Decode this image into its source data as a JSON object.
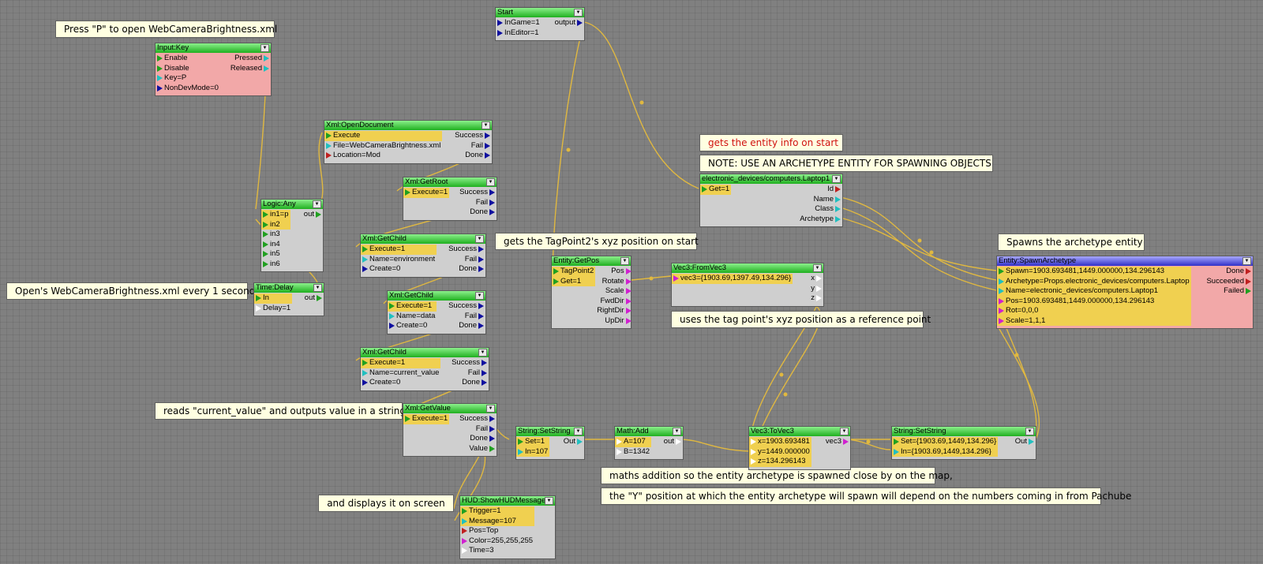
{
  "comments": {
    "press_p": "Press \"P\" to open WebCameraBrightness.xml",
    "opens_xml": "Open's WebCameraBrightness.xml every 1 second",
    "entity_info": "gets the entity info on start",
    "note_archetype": "NOTE: USE AN ARCHETYPE ENTITY FOR SPAWNING OBJECTS",
    "tagpoint": "gets the TagPoint2's xyz position on start",
    "spawns": "Spawns the archetype entity",
    "reference": "uses the tag point's xyz position as a reference point",
    "reads_value": "reads \"current_value\" and outputs value in a string",
    "displays": "and displays it on screen",
    "maths": "maths addition so the entity archetype is spawned close by on the map,",
    "y_position": "the \"Y\" position at which the entity archetype will spawn will depend on the numbers coming in from Pachube"
  },
  "nodes": {
    "start": {
      "title": "Start",
      "inputs": [
        {
          "label": "InGame=1",
          "color": "blue"
        },
        {
          "label": "InEditor=1",
          "color": "blue"
        }
      ],
      "outputs": [
        {
          "label": "output",
          "color": "blue"
        }
      ]
    },
    "input_key": {
      "title": "Input:Key",
      "inputs": [
        {
          "label": "Enable",
          "color": "green"
        },
        {
          "label": "Disable",
          "color": "green"
        },
        {
          "label": "Key=P",
          "color": "cyan"
        },
        {
          "label": "NonDevMode=0",
          "color": "blue"
        }
      ],
      "outputs": [
        {
          "label": "Pressed",
          "color": "cyan"
        },
        {
          "label": "Released",
          "color": "cyan"
        }
      ]
    },
    "xml_open": {
      "title": "Xml:OpenDocument",
      "inputs": [
        {
          "label": "Execute",
          "color": "green",
          "hl": true
        },
        {
          "label": "File=WebCameraBrightness.xml",
          "color": "cyan"
        },
        {
          "label": "Location=Mod",
          "color": "red"
        }
      ],
      "outputs": [
        {
          "label": "Success",
          "color": "blue"
        },
        {
          "label": "Fail",
          "color": "blue"
        },
        {
          "label": "Done",
          "color": "blue"
        }
      ]
    },
    "xml_getroot": {
      "title": "Xml:GetRoot",
      "inputs": [
        {
          "label": "Execute=1",
          "color": "green",
          "hl": true
        }
      ],
      "outputs": [
        {
          "label": "Success",
          "color": "blue"
        },
        {
          "label": "Fail",
          "color": "blue"
        },
        {
          "label": "Done",
          "color": "blue"
        }
      ]
    },
    "logic_any": {
      "title": "Logic:Any",
      "inputs": [
        {
          "label": "in1=p",
          "color": "green",
          "hl": true
        },
        {
          "label": "in2",
          "color": "green",
          "hl": true
        },
        {
          "label": "in3",
          "color": "green"
        },
        {
          "label": "in4",
          "color": "green"
        },
        {
          "label": "in5",
          "color": "green"
        },
        {
          "label": "in6",
          "color": "green"
        }
      ],
      "outputs": [
        {
          "label": "out",
          "color": "green"
        }
      ]
    },
    "xml_getchild1": {
      "title": "Xml:GetChild",
      "inputs": [
        {
          "label": "Execute=1",
          "color": "green",
          "hl": true
        },
        {
          "label": "Name=environment",
          "color": "cyan"
        },
        {
          "label": "Create=0",
          "color": "blue"
        }
      ],
      "outputs": [
        {
          "label": "Success",
          "color": "blue"
        },
        {
          "label": "Fail",
          "color": "blue"
        },
        {
          "label": "Done",
          "color": "blue"
        }
      ]
    },
    "time_delay": {
      "title": "Time:Delay",
      "inputs": [
        {
          "label": "In",
          "color": "green",
          "hl": true
        },
        {
          "label": "Delay=1",
          "color": "hollow"
        }
      ],
      "outputs": [
        {
          "label": "out",
          "color": "green"
        }
      ]
    },
    "xml_getchild2": {
      "title": "Xml:GetChild",
      "inputs": [
        {
          "label": "Execute=1",
          "color": "green",
          "hl": true
        },
        {
          "label": "Name=data",
          "color": "cyan"
        },
        {
          "label": "Create=0",
          "color": "blue"
        }
      ],
      "outputs": [
        {
          "label": "Success",
          "color": "blue"
        },
        {
          "label": "Fail",
          "color": "blue"
        },
        {
          "label": "Done",
          "color": "blue"
        }
      ]
    },
    "xml_getchild3": {
      "title": "Xml:GetChild",
      "inputs": [
        {
          "label": "Execute=1",
          "color": "green",
          "hl": true
        },
        {
          "label": "Name=current_value",
          "color": "cyan"
        },
        {
          "label": "Create=0",
          "color": "blue"
        }
      ],
      "outputs": [
        {
          "label": "Success",
          "color": "blue"
        },
        {
          "label": "Fail",
          "color": "blue"
        },
        {
          "label": "Done",
          "color": "blue"
        }
      ]
    },
    "xml_getvalue": {
      "title": "Xml:GetValue",
      "inputs": [
        {
          "label": "Execute=1",
          "color": "green",
          "hl": true
        }
      ],
      "outputs": [
        {
          "label": "Success",
          "color": "blue"
        },
        {
          "label": "Fail",
          "color": "blue"
        },
        {
          "label": "Done",
          "color": "blue"
        },
        {
          "label": "Value",
          "color": "green"
        }
      ]
    },
    "hud_message": {
      "title": "HUD:ShowHUDMessage",
      "inputs": [
        {
          "label": "Trigger=1",
          "color": "green",
          "hl": true
        },
        {
          "label": "Message=107",
          "color": "cyan",
          "hl": true
        },
        {
          "label": "Pos=Top",
          "color": "red"
        },
        {
          "label": "Color=255,255,255",
          "color": "magenta"
        },
        {
          "label": "Time=3",
          "color": "hollow"
        }
      ],
      "outputs": []
    },
    "string_set1": {
      "title": "String:SetString",
      "inputs": [
        {
          "label": "Set=1",
          "color": "green",
          "hl": true
        },
        {
          "label": "In=107",
          "color": "cyan",
          "hl": true
        }
      ],
      "outputs": [
        {
          "label": "Out",
          "color": "cyan"
        }
      ]
    },
    "math_add": {
      "title": "Math:Add",
      "inputs": [
        {
          "label": "A=107",
          "color": "hollow",
          "hl": true
        },
        {
          "label": "B=1342",
          "color": "hollow"
        }
      ],
      "outputs": [
        {
          "label": "out",
          "color": "hollow"
        }
      ]
    },
    "entity_getpos": {
      "title": "Entity:GetPos",
      "inputs": [
        {
          "label": "TagPoint2",
          "color": "green",
          "hl": true
        },
        {
          "label": "Get=1",
          "color": "green",
          "hl": true
        }
      ],
      "outputs": [
        {
          "label": "Pos",
          "color": "magenta"
        },
        {
          "label": "Rotate",
          "color": "magenta"
        },
        {
          "label": "Scale",
          "color": "magenta"
        },
        {
          "label": "FwdDir",
          "color": "magenta"
        },
        {
          "label": "RightDir",
          "color": "magenta"
        },
        {
          "label": "UpDir",
          "color": "magenta"
        }
      ]
    },
    "vec3_from": {
      "title": "Vec3:FromVec3",
      "inputs": [
        {
          "label": "vec3={1903.69,1397.49,134.296}",
          "color": "magenta",
          "hl": true
        }
      ],
      "outputs": [
        {
          "label": "x",
          "color": "hollow"
        },
        {
          "label": "y",
          "color": "hollow"
        },
        {
          "label": "z",
          "color": "hollow"
        }
      ]
    },
    "entity_laptop": {
      "title": "electronic_devices/computers.Laptop1",
      "inputs": [
        {
          "label": "Get=1",
          "color": "green",
          "hl": true
        }
      ],
      "outputs": [
        {
          "label": "Id",
          "color": "red"
        },
        {
          "label": "Name",
          "color": "cyan"
        },
        {
          "label": "Class",
          "color": "cyan"
        },
        {
          "label": "Archetype",
          "color": "cyan"
        }
      ]
    },
    "vec3_to": {
      "title": "Vec3:ToVec3",
      "inputs": [
        {
          "label": "x=1903.693481",
          "color": "hollow",
          "hl": true
        },
        {
          "label": "y=1449.000000",
          "color": "hollow",
          "hl": true
        },
        {
          "label": "z=134.296143",
          "color": "hollow",
          "hl": true
        }
      ],
      "outputs": [
        {
          "label": "vec3",
          "color": "magenta"
        }
      ]
    },
    "string_set2": {
      "title": "String:SetString",
      "inputs": [
        {
          "label": "Set={1903.69,1449,134.296}",
          "color": "green",
          "hl": true
        },
        {
          "label": "In={1903.69,1449,134.296}",
          "color": "cyan",
          "hl": true
        }
      ],
      "outputs": [
        {
          "label": "Out",
          "color": "cyan"
        }
      ]
    },
    "spawn": {
      "title": "Entity:SpawnArchetype",
      "inputs": [
        {
          "label": "Spawn=1903.693481,1449.000000,134.296143",
          "color": "green",
          "hl": true
        },
        {
          "label": "Archetype=Props.electronic_devices/computers.Laptop",
          "color": "cyan",
          "hl": true
        },
        {
          "label": "Name=electronic_devices/computers.Laptop1",
          "color": "cyan",
          "hl": true
        },
        {
          "label": "Pos=1903.693481,1449.000000,134.296143",
          "color": "magenta",
          "hl": true
        },
        {
          "label": "Rot=0,0,0",
          "color": "magenta",
          "hl": true
        },
        {
          "label": "Scale=1,1,1",
          "color": "magenta",
          "hl": true
        }
      ],
      "outputs": [
        {
          "label": "Done",
          "color": "red"
        },
        {
          "label": "Succeeded",
          "color": "red"
        },
        {
          "label": "Failed",
          "color": "green"
        }
      ]
    }
  }
}
